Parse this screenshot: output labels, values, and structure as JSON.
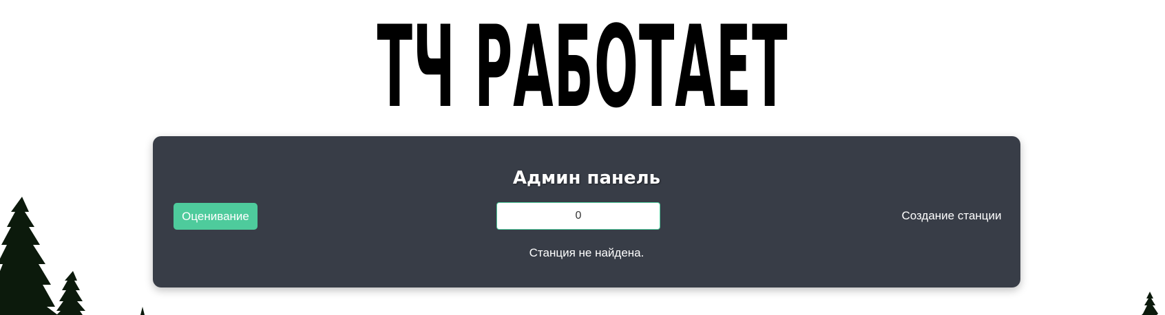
{
  "header": {
    "title": "ТЧ РАБОТАЕТ"
  },
  "panel": {
    "title": "Админ панель",
    "rate_button_label": "Оценивание",
    "station_input_value": "0",
    "create_station_label": "Создание станции",
    "status_message": "Станция не найдена."
  },
  "colors": {
    "panel_background": "#383d47",
    "accent": "#4ecb9c",
    "tree": "#0c1a0c"
  },
  "icons": {
    "decoration": "pine-tree-icon"
  }
}
